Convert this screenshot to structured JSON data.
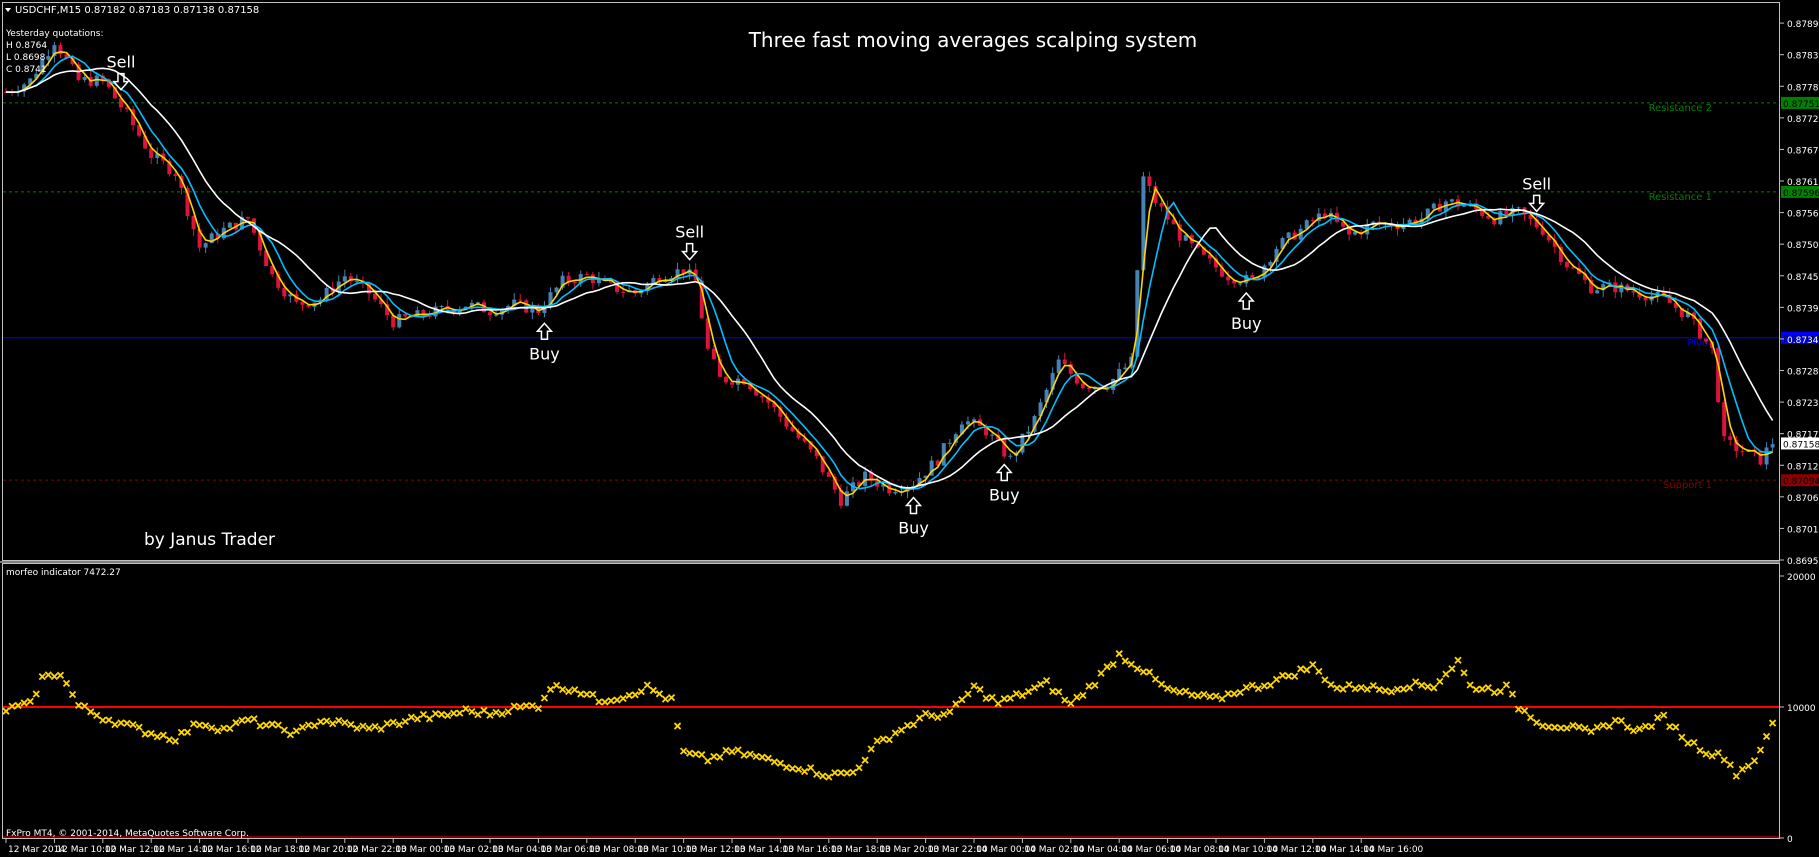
{
  "window": {
    "symbol_info": "USDCHF,M15  0.87182 0.87183 0.87138 0.87158",
    "footer": "FxPro MT4, © 2001-2014, MetaQuotes Software Corp."
  },
  "annotations": {
    "title": "Three fast moving averages scalping system",
    "author": "by Janus Trader",
    "yesterday_title": "Yesterday quotations:",
    "yesterday_high": "H 0.8764",
    "yesterday_low": "L 0.8698",
    "yesterday_close": "C 0.8741",
    "signals": [
      {
        "label": "Sell",
        "x_index": 19,
        "direction": "down"
      },
      {
        "label": "Buy",
        "x_index": 89,
        "direction": "up"
      },
      {
        "label": "Sell",
        "x_index": 113,
        "direction": "down"
      },
      {
        "label": "Buy",
        "x_index": 150,
        "direction": "up"
      },
      {
        "label": "Buy",
        "x_index": 165,
        "direction": "up"
      },
      {
        "label": "Buy",
        "x_index": 205,
        "direction": "up"
      },
      {
        "label": "Sell",
        "x_index": 253,
        "direction": "down"
      }
    ]
  },
  "levels": [
    {
      "name": "Resistance 2",
      "price": 0.87751,
      "label": "0.87751",
      "color": "#008000",
      "style": "dashed"
    },
    {
      "name": "Resistance 1",
      "price": 0.87596,
      "label": "0.87596",
      "color": "#008000",
      "style": "dashed"
    },
    {
      "name": "Pivot",
      "price": 0.87342,
      "label": "0.87342",
      "color": "#0000ff",
      "style": "solid"
    },
    {
      "name": "Support 1",
      "price": 0.87094,
      "label": "0.87094",
      "color": "#8b0000",
      "style": "dashed"
    }
  ],
  "indicator": {
    "label": "morfeo indicator 7472.27",
    "level": 10000,
    "level_color": "#ff0000",
    "marker_color": "#ffd700"
  },
  "chart_data": {
    "type": "candlestick",
    "price_axis_ticks": [
      "0.87890",
      "0.87835",
      "0.87780",
      "0.87725",
      "0.87670",
      "0.87615",
      "0.87560",
      "0.87505",
      "0.87450",
      "0.87395",
      "0.87340",
      "0.87285",
      "0.87230",
      "0.87175",
      "0.87120",
      "0.87065",
      "0.87010",
      "0.86955"
    ],
    "current_price": "0.87158",
    "price_range": [
      0.86955,
      0.87925
    ],
    "indicator_axis_ticks": [
      "20000",
      "10000",
      "0"
    ],
    "indicator_range": [
      0,
      20000
    ],
    "time_labels": [
      "12 Mar 2014",
      "12 Mar 10:00",
      "12 Mar 12:00",
      "12 Mar 14:00",
      "12 Mar 16:00",
      "12 Mar 18:00",
      "12 Mar 20:00",
      "12 Mar 22:00",
      "13 Mar 00:00",
      "13 Mar 02:00",
      "13 Mar 04:00",
      "13 Mar 06:00",
      "13 Mar 08:00",
      "13 Mar 10:00",
      "13 Mar 12:00",
      "13 Mar 14:00",
      "13 Mar 16:00",
      "13 Mar 18:00",
      "13 Mar 20:00",
      "13 Mar 22:00",
      "14 Mar 00:00",
      "14 Mar 02:00",
      "14 Mar 04:00",
      "14 Mar 06:00",
      "14 Mar 08:00",
      "14 Mar 10:00",
      "14 Mar 12:00",
      "14 Mar 14:00",
      "14 Mar 16:00"
    ],
    "bars_per_label": 8,
    "price_anchors": [
      [
        0,
        0.8777
      ],
      [
        4,
        0.8779
      ],
      [
        8,
        0.8786
      ],
      [
        12,
        0.8779
      ],
      [
        16,
        0.8779
      ],
      [
        20,
        0.8773
      ],
      [
        24,
        0.8766
      ],
      [
        28,
        0.8763
      ],
      [
        32,
        0.875
      ],
      [
        36,
        0.8753
      ],
      [
        40,
        0.8755
      ],
      [
        44,
        0.8745
      ],
      [
        48,
        0.874
      ],
      [
        52,
        0.8741
      ],
      [
        56,
        0.8745
      ],
      [
        60,
        0.8742
      ],
      [
        64,
        0.8737
      ],
      [
        68,
        0.8738
      ],
      [
        72,
        0.8739
      ],
      [
        76,
        0.874
      ],
      [
        80,
        0.8739
      ],
      [
        84,
        0.874
      ],
      [
        88,
        0.8739
      ],
      [
        92,
        0.8744
      ],
      [
        96,
        0.8745
      ],
      [
        100,
        0.8743
      ],
      [
        104,
        0.8742
      ],
      [
        108,
        0.8745
      ],
      [
        112,
        0.8746
      ],
      [
        114,
        0.8744
      ],
      [
        116,
        0.8732
      ],
      [
        118,
        0.8727
      ],
      [
        122,
        0.8727
      ],
      [
        126,
        0.8723
      ],
      [
        130,
        0.8718
      ],
      [
        134,
        0.8713
      ],
      [
        138,
        0.8706
      ],
      [
        142,
        0.871
      ],
      [
        146,
        0.8708
      ],
      [
        150,
        0.8709
      ],
      [
        154,
        0.8713
      ],
      [
        158,
        0.872
      ],
      [
        162,
        0.8718
      ],
      [
        166,
        0.8713
      ],
      [
        170,
        0.872
      ],
      [
        174,
        0.873
      ],
      [
        178,
        0.8726
      ],
      [
        182,
        0.8726
      ],
      [
        186,
        0.873
      ],
      [
        188,
        0.8762
      ],
      [
        190,
        0.8758
      ],
      [
        194,
        0.8752
      ],
      [
        198,
        0.8748
      ],
      [
        202,
        0.8745
      ],
      [
        206,
        0.8744
      ],
      [
        210,
        0.875
      ],
      [
        214,
        0.8753
      ],
      [
        218,
        0.8756
      ],
      [
        222,
        0.8752
      ],
      [
        226,
        0.8754
      ],
      [
        230,
        0.8754
      ],
      [
        234,
        0.8755
      ],
      [
        238,
        0.8758
      ],
      [
        242,
        0.8757
      ],
      [
        246,
        0.8755
      ],
      [
        250,
        0.8756
      ],
      [
        254,
        0.8753
      ],
      [
        258,
        0.8747
      ],
      [
        262,
        0.8743
      ],
      [
        266,
        0.8743
      ],
      [
        270,
        0.8742
      ],
      [
        274,
        0.8741
      ],
      [
        278,
        0.8738
      ],
      [
        282,
        0.8732
      ],
      [
        284,
        0.8716
      ],
      [
        288,
        0.8714
      ],
      [
        290,
        0.8713
      ],
      [
        292,
        0.8716
      ]
    ],
    "indicator_anchors": [
      [
        0,
        9800
      ],
      [
        4,
        10200
      ],
      [
        6,
        12200
      ],
      [
        9,
        12600
      ],
      [
        12,
        10100
      ],
      [
        16,
        9200
      ],
      [
        20,
        8600
      ],
      [
        24,
        8000
      ],
      [
        28,
        7600
      ],
      [
        32,
        8800
      ],
      [
        36,
        8300
      ],
      [
        40,
        9000
      ],
      [
        44,
        8500
      ],
      [
        48,
        8000
      ],
      [
        52,
        9000
      ],
      [
        56,
        8700
      ],
      [
        60,
        8300
      ],
      [
        64,
        8700
      ],
      [
        68,
        9200
      ],
      [
        72,
        9300
      ],
      [
        76,
        9700
      ],
      [
        80,
        9500
      ],
      [
        84,
        9900
      ],
      [
        88,
        10100
      ],
      [
        90,
        11500
      ],
      [
        94,
        11400
      ],
      [
        98,
        10500
      ],
      [
        102,
        10800
      ],
      [
        106,
        11500
      ],
      [
        110,
        10500
      ],
      [
        112,
        6500
      ],
      [
        116,
        6000
      ],
      [
        120,
        6600
      ],
      [
        124,
        6200
      ],
      [
        128,
        5700
      ],
      [
        132,
        5300
      ],
      [
        136,
        4800
      ],
      [
        140,
        5000
      ],
      [
        144,
        7200
      ],
      [
        148,
        8300
      ],
      [
        152,
        9300
      ],
      [
        156,
        9500
      ],
      [
        160,
        11500
      ],
      [
        164,
        10300
      ],
      [
        168,
        11000
      ],
      [
        172,
        11800
      ],
      [
        176,
        10200
      ],
      [
        180,
        11900
      ],
      [
        184,
        14000
      ],
      [
        188,
        12800
      ],
      [
        192,
        11300
      ],
      [
        196,
        10900
      ],
      [
        200,
        10600
      ],
      [
        204,
        11300
      ],
      [
        208,
        11700
      ],
      [
        212,
        12400
      ],
      [
        216,
        13100
      ],
      [
        220,
        11400
      ],
      [
        224,
        11600
      ],
      [
        228,
        11300
      ],
      [
        232,
        11700
      ],
      [
        236,
        11600
      ],
      [
        240,
        13500
      ],
      [
        242,
        11600
      ],
      [
        246,
        11300
      ],
      [
        248,
        11500
      ],
      [
        250,
        10000
      ],
      [
        254,
        8700
      ],
      [
        258,
        8500
      ],
      [
        262,
        8000
      ],
      [
        266,
        9000
      ],
      [
        270,
        8200
      ],
      [
        274,
        9200
      ],
      [
        278,
        7400
      ],
      [
        282,
        6400
      ],
      [
        284,
        6200
      ],
      [
        286,
        4900
      ],
      [
        288,
        5600
      ],
      [
        290,
        6500
      ],
      [
        292,
        8800
      ]
    ]
  }
}
